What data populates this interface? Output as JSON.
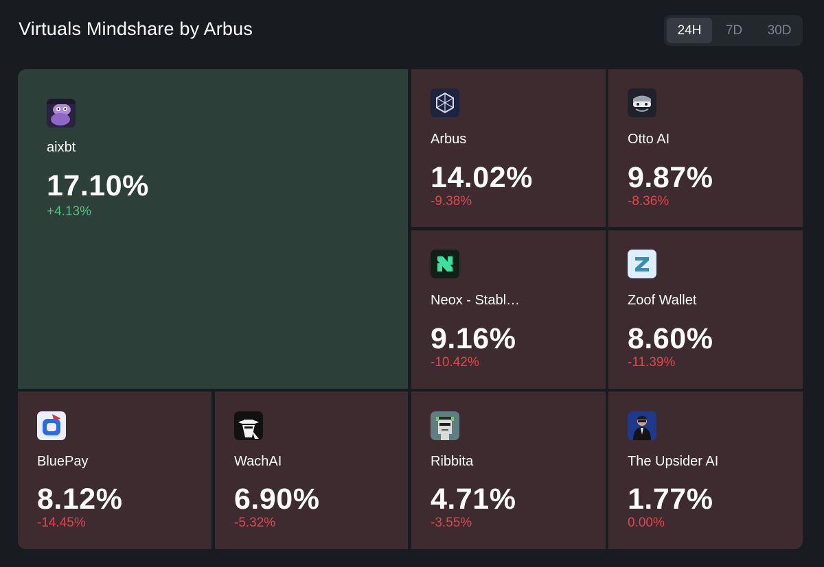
{
  "header": {
    "title": "Virtuals Mindshare by Arbus",
    "ranges": [
      "24H",
      "7D",
      "30D"
    ],
    "active_range": "24H"
  },
  "colors": {
    "up_tile": "#2d3f39",
    "down_tile": "#3d2b2f",
    "positive": "#4fc27a",
    "negative": "#e0474c"
  },
  "tiles": [
    {
      "name": "aixbt",
      "share": "17.10%",
      "change": "+4.13%",
      "icon": "aixbt-avatar-icon"
    },
    {
      "name": "Arbus",
      "share": "14.02%",
      "change": "-9.38%",
      "icon": "arbus-logo-icon"
    },
    {
      "name": "Otto AI",
      "share": "9.87%",
      "change": "-8.36%",
      "icon": "otto-ai-logo-icon"
    },
    {
      "name": "Neox - Stabl…",
      "share": "9.16%",
      "change": "-10.42%",
      "icon": "neox-logo-icon"
    },
    {
      "name": "Zoof Wallet",
      "share": "8.60%",
      "change": "-11.39%",
      "icon": "zoof-wallet-logo-icon"
    },
    {
      "name": "BluePay",
      "share": "8.12%",
      "change": "-14.45%",
      "icon": "bluepay-logo-icon"
    },
    {
      "name": "WachAI",
      "share": "6.90%",
      "change": "-5.32%",
      "icon": "wachai-logo-icon"
    },
    {
      "name": "Ribbita",
      "share": "4.71%",
      "change": "-3.55%",
      "icon": "ribbita-avatar-icon"
    },
    {
      "name": "The Upsider AI",
      "share": "1.77%",
      "change": "0.00%",
      "icon": "upsider-ai-avatar-icon"
    }
  ]
}
